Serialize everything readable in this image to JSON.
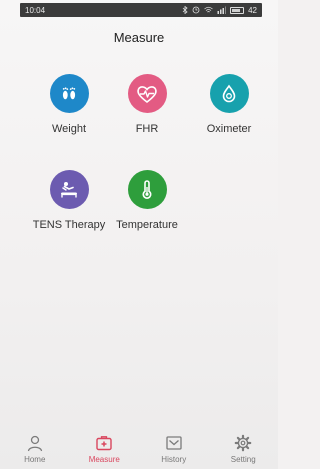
{
  "status_bar": {
    "time": "10:04",
    "battery": "42"
  },
  "header": {
    "title": "Measure"
  },
  "tiles": [
    {
      "label": "Weight",
      "icon": "footprints-icon",
      "color": "#1e88c9"
    },
    {
      "label": "FHR",
      "icon": "heart-pulse-icon",
      "color": "#e35b83"
    },
    {
      "label": "Oximeter",
      "icon": "oximeter-drop-icon",
      "color": "#17a1ad"
    },
    {
      "label": "TENS Therapy",
      "icon": "massage-person-icon",
      "color": "#6c5bb0"
    },
    {
      "label": "Temperature",
      "icon": "thermometer-icon",
      "color": "#2e9e3c"
    }
  ],
  "tab_bar": {
    "active": "Measure",
    "accent": "#d9465e",
    "items": [
      {
        "label": "Home",
        "icon": "person-icon"
      },
      {
        "label": "Measure",
        "icon": "medical-kit-icon"
      },
      {
        "label": "History",
        "icon": "inbox-icon"
      },
      {
        "label": "Setting",
        "icon": "gear-icon"
      }
    ]
  }
}
